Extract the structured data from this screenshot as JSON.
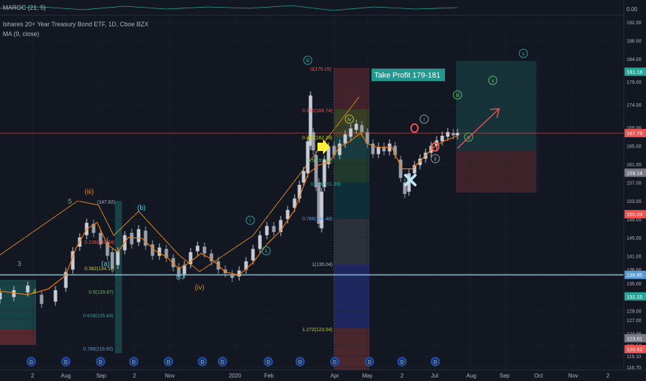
{
  "indicator_top": {
    "label": "MAROC (21, 5)",
    "value": "0.00"
  },
  "instrument": {
    "title": "Ishares 20+ Year Treasury Bond ETF, 1D, Cboe BZX"
  },
  "ma_indicator": {
    "label": "MA (9, close)"
  },
  "colors": {
    "background": "#131722",
    "grid": "#1f2433",
    "up": "#c8ccd4",
    "down": "#9aa0aa",
    "ma": "#f57c00",
    "wave_line": "#e08a1e",
    "resistance": "#ef5350",
    "support": "#9fd3e8",
    "elliott_marker": "#26a69a",
    "axis_text": "#b2b5be"
  },
  "chart_data": {
    "type": "candlestick",
    "x_tick_labels": [
      "2",
      "Aug",
      "Sep",
      "2",
      "Nov",
      "2020",
      "Feb",
      "Apr",
      "May",
      "2",
      "Jul",
      "Aug",
      "Sep",
      "Oct",
      "Nov",
      "2"
    ],
    "y_tick_labels": [
      "192.00",
      "188.00",
      "184.00",
      "179.00",
      "174.00",
      "169.00",
      "165.00",
      "161.00",
      "157.00",
      "153.00",
      "149.00",
      "145.00",
      "141.00",
      "138.00",
      "135.00",
      "129.00",
      "127.00",
      "124.00",
      "121.50",
      "119.10",
      "116.70"
    ],
    "ylim": [
      116.7,
      192.0
    ],
    "price_tags": [
      {
        "value": 181.18,
        "text": "181.18",
        "color": "#26a69a"
      },
      {
        "value": 167.79,
        "text": "167.79",
        "color": "#ef5350"
      },
      {
        "value": 159.14,
        "text": "159.14",
        "color": "#787b86"
      },
      {
        "value": 150.09,
        "text": "150.09",
        "color": "#ef5350"
      },
      {
        "value": 136.85,
        "text": "136.85",
        "color": "#5b9bd5"
      },
      {
        "value": 132.15,
        "text": "132.15",
        "color": "#26a69a"
      },
      {
        "value": 123.01,
        "text": "123.01",
        "color": "#787b86"
      },
      {
        "value": 120.62,
        "text": "120.62",
        "color": "#ef5350"
      }
    ],
    "horizontal_lines": [
      {
        "name": "resistance",
        "value": 167.79
      },
      {
        "name": "support",
        "value": 136.85
      }
    ],
    "ma_approx": [
      [
        0,
        133.3
      ],
      [
        40,
        132.5
      ],
      [
        70,
        133.8
      ],
      [
        95,
        136.8
      ],
      [
        110,
        142.8
      ],
      [
        125,
        146.8
      ],
      [
        140,
        148.3
      ],
      [
        155,
        143.5
      ],
      [
        170,
        141.8
      ],
      [
        185,
        145
      ],
      [
        205,
        144.8
      ],
      [
        225,
        142
      ],
      [
        240,
        140.8
      ],
      [
        258,
        138.2
      ],
      [
        270,
        139.2
      ],
      [
        290,
        141.5
      ],
      [
        305,
        140.3
      ],
      [
        325,
        137.5
      ],
      [
        345,
        136.8
      ],
      [
        365,
        139.5
      ],
      [
        385,
        143.5
      ],
      [
        405,
        146.5
      ],
      [
        425,
        151
      ],
      [
        445,
        159
      ],
      [
        460,
        160.8
      ],
      [
        475,
        161.5
      ],
      [
        490,
        164.8
      ],
      [
        505,
        166
      ],
      [
        520,
        167.8
      ],
      [
        530,
        165.5
      ],
      [
        545,
        164.6
      ],
      [
        565,
        164.8
      ],
      [
        580,
        160
      ],
      [
        595,
        160
      ],
      [
        610,
        162.3
      ],
      [
        625,
        164.6
      ],
      [
        640,
        166
      ],
      [
        660,
        167.2
      ]
    ],
    "candles_approx": [
      [
        0,
        131.5,
        133
      ],
      [
        20,
        132,
        133.5
      ],
      [
        40,
        133,
        134.5
      ],
      [
        60,
        132.5,
        130.5
      ],
      [
        80,
        131,
        133.5
      ],
      [
        95,
        134,
        137.5
      ],
      [
        105,
        138,
        142
      ],
      [
        115,
        143,
        145
      ],
      [
        125,
        145.5,
        148.2
      ],
      [
        135,
        148,
        146
      ],
      [
        145,
        146,
        143.5
      ],
      [
        155,
        144,
        141
      ],
      [
        162,
        141.8,
        138.2
      ],
      [
        170,
        139,
        142
      ],
      [
        180,
        142.2,
        145.5
      ],
      [
        190,
        146,
        143.5
      ],
      [
        200,
        144,
        146.8
      ],
      [
        210,
        146.5,
        143.2
      ],
      [
        220,
        143.5,
        141
      ],
      [
        230,
        141,
        142.8
      ],
      [
        240,
        142.5,
        140.5
      ],
      [
        250,
        140.5,
        138.5
      ],
      [
        258,
        138.5,
        136.5
      ],
      [
        266,
        137,
        139
      ],
      [
        275,
        139.2,
        141.8
      ],
      [
        285,
        142,
        143.2
      ],
      [
        295,
        143,
        141.5
      ],
      [
        305,
        141.5,
        139.8
      ],
      [
        315,
        139.8,
        138
      ],
      [
        325,
        138,
        137.2
      ],
      [
        335,
        137,
        136.2
      ],
      [
        345,
        136.5,
        137.8
      ],
      [
        355,
        138,
        139.8
      ],
      [
        365,
        140,
        142.5
      ],
      [
        375,
        142.5,
        145.5
      ],
      [
        385,
        145.5,
        147.5
      ],
      [
        395,
        147.5,
        146.2
      ],
      [
        405,
        146.2,
        148.8
      ],
      [
        415,
        149,
        151
      ],
      [
        425,
        151.5,
        153.5
      ],
      [
        432,
        153.5,
        156.5
      ],
      [
        438,
        157,
        159.5
      ],
      [
        444,
        159,
        166
      ],
      [
        448,
        165,
        176
      ],
      [
        452,
        168,
        164
      ],
      [
        456,
        163,
        156
      ],
      [
        460,
        157,
        148
      ],
      [
        464,
        147,
        155
      ],
      [
        468,
        156,
        162
      ],
      [
        474,
        161,
        164.8
      ],
      [
        482,
        165,
        163
      ],
      [
        490,
        163,
        165.5
      ],
      [
        498,
        165.5,
        167.5
      ],
      [
        506,
        167,
        168.8
      ],
      [
        514,
        168.5,
        169.8
      ],
      [
        522,
        169.5,
        168
      ],
      [
        530,
        168,
        165.5
      ],
      [
        538,
        165.5,
        163.2
      ],
      [
        546,
        163.2,
        164.8
      ],
      [
        554,
        164.8,
        163.8
      ],
      [
        562,
        163.8,
        165.5
      ],
      [
        570,
        165,
        163
      ],
      [
        578,
        162,
        158
      ],
      [
        584,
        157,
        154.5
      ],
      [
        590,
        155,
        159
      ],
      [
        598,
        159,
        160.8
      ],
      [
        606,
        160.8,
        162.2
      ],
      [
        614,
        162.2,
        163.5
      ],
      [
        622,
        163.5,
        165
      ],
      [
        630,
        165,
        166.2
      ],
      [
        638,
        166,
        167.2
      ],
      [
        646,
        167,
        168
      ],
      [
        654,
        167.8,
        167.3
      ],
      [
        660,
        167.3,
        167.8
      ]
    ]
  },
  "annotations": {
    "take_profit": "Take Profit 179-181",
    "fib_levels": [
      "0(179.15)",
      "0.236(168.74)",
      "0.382(162.29)",
      "0.5(157.09)",
      "0.618(151.89)",
      "0.786(144.48)",
      "1(135.04)",
      "1.272(123.04)"
    ],
    "fib_levels_left": [
      "(147.82)",
      "0.236(139.04)",
      "0.382(134.11)",
      "0.5(129.87)",
      "0.618(125.64)",
      "0.786(119.60)"
    ],
    "waves_major": [
      "(iii)",
      "(b)",
      "(a)",
      "(c)",
      "(iv)"
    ],
    "waves_counts": [
      "5",
      "3",
      "4"
    ],
    "waves_minor": [
      "iii",
      "i",
      "ii",
      "iv",
      "i",
      "ii",
      "iii",
      "iv",
      "v",
      "v"
    ],
    "event_marker": "D"
  }
}
